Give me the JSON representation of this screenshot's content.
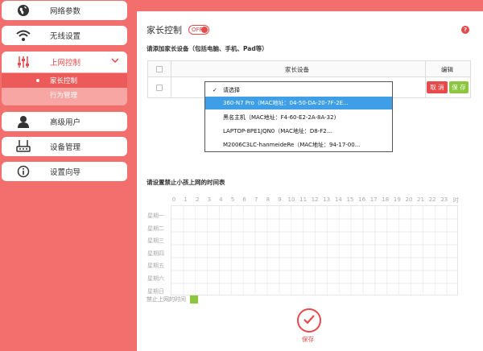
{
  "sidebar": {
    "items": [
      {
        "label": "网络参数",
        "icon": "globe-icon"
      },
      {
        "label": "无线设置",
        "icon": "wifi-icon"
      },
      {
        "label": "上网控制",
        "icon": "sliders-icon"
      },
      {
        "label": "高级用户",
        "icon": "user-icon"
      },
      {
        "label": "设备管理",
        "icon": "router-icon"
      },
      {
        "label": "设置向导",
        "icon": "info-icon"
      }
    ],
    "submenu": [
      {
        "label": "家长控制"
      },
      {
        "label": "行为管理"
      }
    ]
  },
  "main": {
    "title": "家长控制",
    "toggle_label": "OFF",
    "help": "?",
    "add_device_label": "请添加家长设备（包括电脑、手机、Pad等）",
    "table": {
      "col_device": "家长设备",
      "col_edit": "编辑",
      "cancel": "取 消",
      "save": "保 存"
    },
    "dropdown": {
      "options": [
        "请选择",
        "360-N7 Pro（MAC地址：04-50-DA-20-7F-2E...",
        "黑名主机（MAC地址：F4-60-E2-2A-8A-32)",
        "LAPTOP-8PE1JQN0（MAC地址：D8-F2...",
        "M2006C3LC-hanmeideRe（MAC地址：94-17-00..."
      ],
      "selected_index": 0,
      "highlighted_index": 1
    },
    "schedule": {
      "label": "请设置禁止小孩上网的时间表",
      "hours": [
        "0",
        "1",
        "2",
        "3",
        "4",
        "5",
        "6",
        "7",
        "8",
        "9",
        "10",
        "11",
        "12",
        "13",
        "14",
        "15",
        "16",
        "17",
        "18",
        "19",
        "20",
        "21",
        "22",
        "23",
        "时"
      ],
      "days": [
        "星期一",
        "星期二",
        "星期三",
        "星期四",
        "星期五",
        "星期六",
        "星期日"
      ]
    },
    "legend_label": "禁止上网的时间",
    "save_label": "保存"
  },
  "colors": {
    "brand": "#e8494a",
    "background": "#f36f6d",
    "green": "#8cc63f",
    "highlight": "#3f9fe6"
  }
}
